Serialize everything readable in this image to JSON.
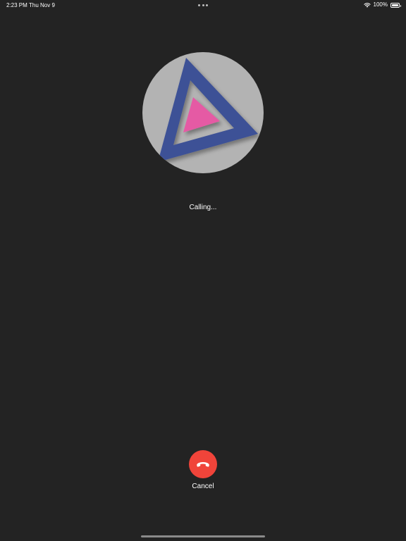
{
  "status_bar": {
    "time": "2:23 PM",
    "date": "Thu Nov 9",
    "battery_percent": "100%"
  },
  "call": {
    "status": "Calling...",
    "cancel_label": "Cancel"
  },
  "icons": {
    "wifi": "wifi-icon",
    "battery": "battery-icon",
    "end_call": "phone-hangup-icon",
    "avatar": "app-logo-triangle"
  },
  "colors": {
    "background": "#232323",
    "end_call_button": "#f0443a",
    "avatar_circle": "#b3b3b3",
    "logo_outer_triangle": "#3d5196",
    "logo_inner_triangle": "#e55aa4"
  }
}
